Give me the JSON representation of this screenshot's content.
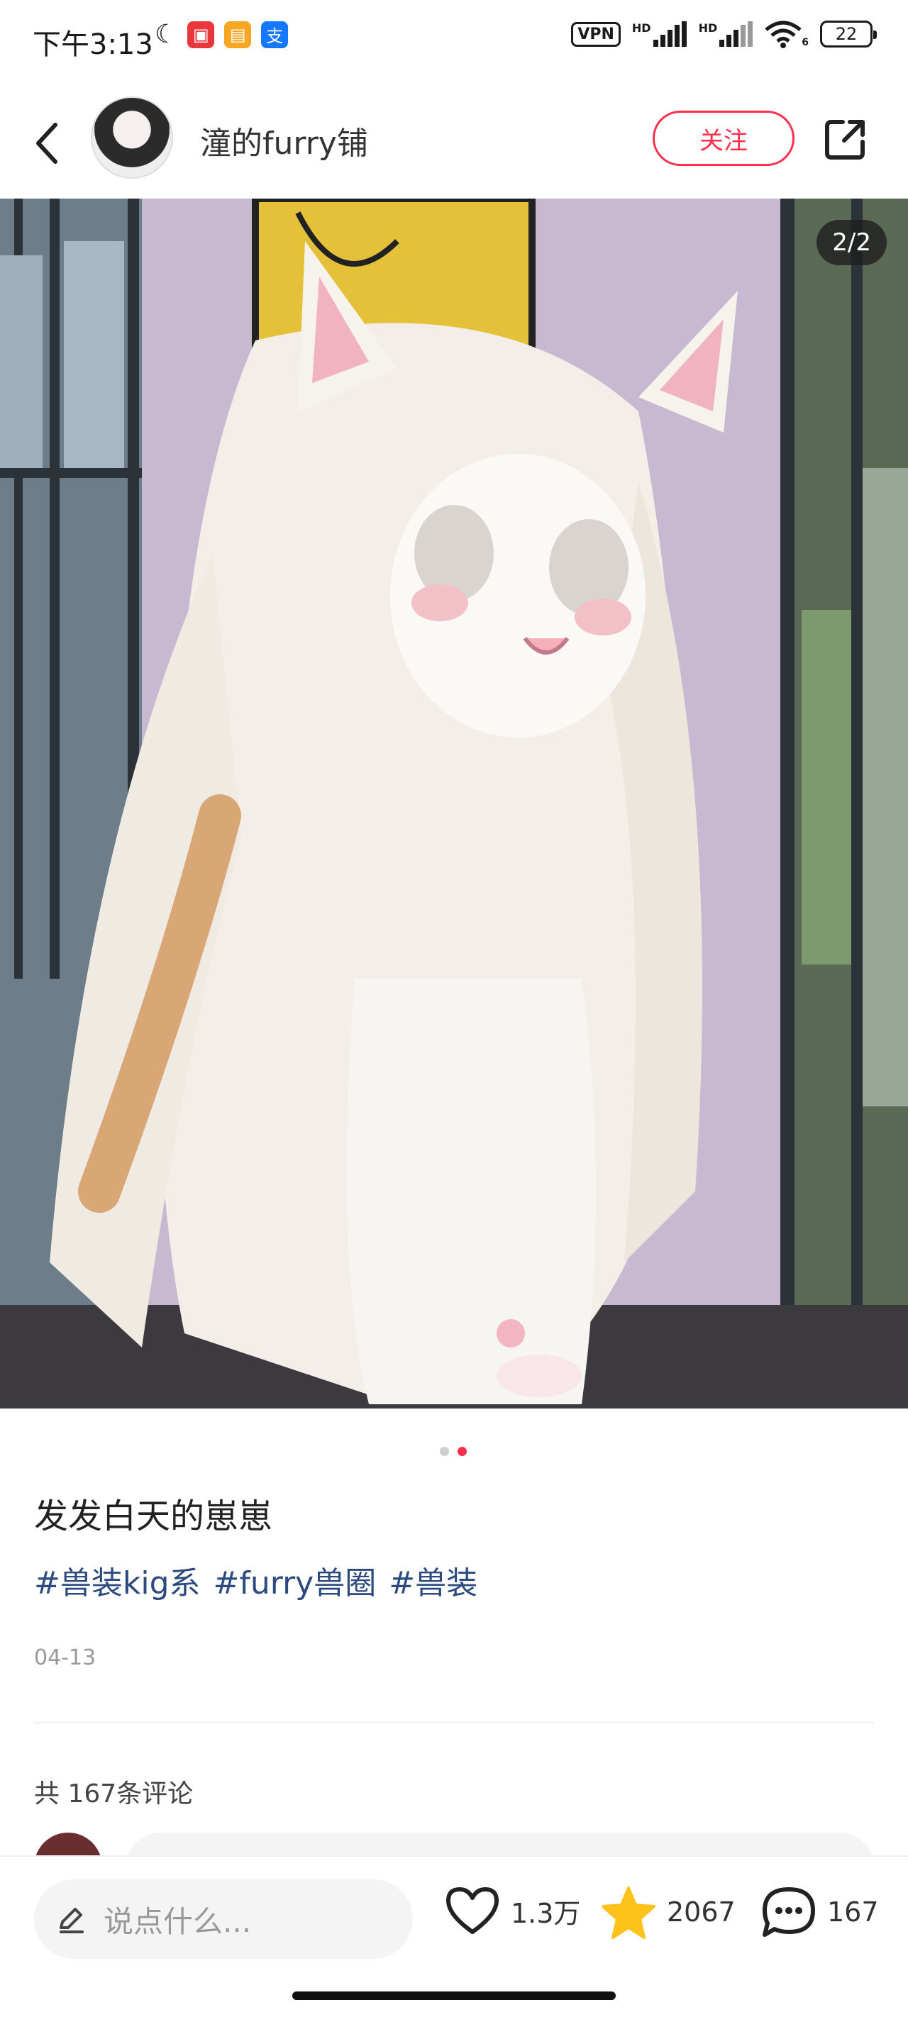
{
  "status_bar": {
    "time": "下午3:13",
    "vpn": "VPN",
    "hd1": "HD",
    "hd2": "HD",
    "wifi_sub": "6",
    "battery": "22",
    "app3_glyph": "支"
  },
  "header": {
    "author_name": "潼的furry铺",
    "follow_label": "关注"
  },
  "gallery": {
    "counter": "2/2",
    "current_index": 2,
    "total": 2
  },
  "post": {
    "title": "发发白天的崽崽",
    "tags": [
      "#兽装kig系",
      "#furry兽圈",
      "#兽装"
    ],
    "date": "04-13"
  },
  "comments": {
    "count_label": "共 167条评论"
  },
  "bottom_bar": {
    "input_placeholder": "说点什么...",
    "likes": "1.3万",
    "collects": "2067",
    "comments": "167"
  },
  "colors": {
    "accent": "#ff2e4d",
    "tag_blue": "#2c4a7e",
    "star": "#ffc21a"
  }
}
